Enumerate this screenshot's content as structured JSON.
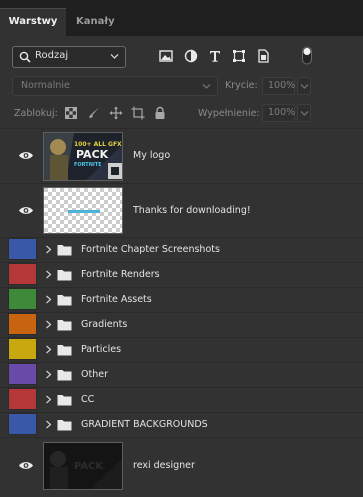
{
  "tabs": [
    {
      "label": "Warstwy",
      "active": true
    },
    {
      "label": "Kanały",
      "active": false
    }
  ],
  "filter": {
    "kind_label": "Rodzaj",
    "icons": [
      "image-filter-icon",
      "adjustment-filter-icon",
      "type-filter-icon",
      "shape-filter-icon",
      "smart-object-filter-icon"
    ],
    "toggle": "filter-toggle-switch"
  },
  "blend": {
    "mode": "Normalnie",
    "opacity_label": "Krycie:",
    "opacity_value": "100%",
    "lock_label": "Zablokuj:",
    "fill_label": "Wypełnienie:",
    "fill_value": "100%"
  },
  "layers": [
    {
      "type": "layer",
      "name": "My logo",
      "visible": true,
      "thumb": "logo",
      "smart_object": true
    },
    {
      "type": "layer",
      "name": "Thanks for downloading!",
      "visible": true,
      "thumb": "transparent"
    },
    {
      "type": "group",
      "name": "Fortnite Chapter Screenshots",
      "color": "#3a58a8"
    },
    {
      "type": "group",
      "name": "Fortnite Renders",
      "color": "#b53737"
    },
    {
      "type": "group",
      "name": "Fortnite Assets",
      "color": "#3e8a3a"
    },
    {
      "type": "group",
      "name": "Gradients",
      "color": "#c8640f"
    },
    {
      "type": "group",
      "name": "Particles",
      "color": "#c8a80e"
    },
    {
      "type": "group",
      "name": "Other",
      "color": "#6a4aa8"
    },
    {
      "type": "group",
      "name": "CC",
      "color": "#b53737"
    },
    {
      "type": "group",
      "name": "GRADIENT BACKGROUNDS",
      "color": "#3a58a8"
    },
    {
      "type": "layer",
      "name": "rexi designer",
      "visible": true,
      "thumb": "dark"
    }
  ],
  "thumb_text": {
    "logo_top": "100+ ALL GFX",
    "logo_main": "PACK",
    "logo_sub": "FORTNITE"
  }
}
